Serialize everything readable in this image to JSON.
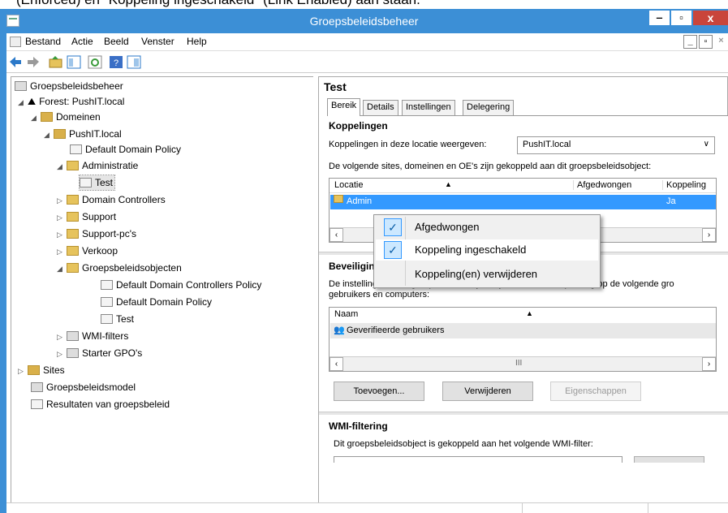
{
  "caption_fragment": "(Enforced) en \"Koppeling ingeschakeld\" (Link Enabled) aan staan.",
  "window": {
    "title": "Groepsbeleidsbeheer",
    "minimize": "‒",
    "maximize": "▫",
    "close": "x"
  },
  "menu": {
    "items": [
      "Bestand",
      "Actie",
      "Beeld",
      "Venster",
      "Help"
    ]
  },
  "tree": {
    "root": "Groepsbeleidsbeheer",
    "forest": "Forest: PushIT.local",
    "domains": "Domeinen",
    "domain": "PushIT.local",
    "ddp_link": "Default Domain Policy",
    "administratie": "Administratie",
    "test_link": "Test",
    "dc": "Domain Controllers",
    "support": "Support",
    "support_pc": "Support-pc's",
    "verkoop": "Verkoop",
    "gpo_container": "Groepsbeleidsobjecten",
    "gpo1": "Default Domain Controllers Policy",
    "gpo2": "Default Domain Policy",
    "gpo3": "Test",
    "wmi": "WMI-filters",
    "starter": "Starter GPO's",
    "sites": "Sites",
    "model": "Groepsbeleidsmodel",
    "results": "Resultaten van groepsbeleid"
  },
  "details": {
    "header": "Test",
    "tabs": [
      "Bereik",
      "Details",
      "Instellingen",
      "Delegering"
    ],
    "links_section": "Koppelingen",
    "links_location_label": "Koppelingen in deze locatie weergeven:",
    "links_location_value": "PushIT.local",
    "links_desc": "De volgende sites, domeinen en OE's zijn gekoppeld aan dit groepsbeleidsobject:",
    "links_cols": [
      "Locatie",
      "Afgedwongen",
      "Koppeling"
    ],
    "links_row": {
      "location": "Admin",
      "linked": "Ja"
    },
    "security_section": "Beveiligingsfiltering",
    "security_desc_1": "De instellingen in dit groepsbeleidsobject zijn alleen van toepassing op de volgende gro",
    "security_desc_2": "gebruikers en computers:",
    "security_col": "Naam",
    "security_row": "Geverifieerde gebruikers",
    "btn_add": "Toevoegen...",
    "btn_remove": "Verwijderen",
    "btn_props": "Eigenschappen",
    "wmi_section": "WMI-filtering",
    "wmi_desc": "Dit groepsbeleidsobject is gekoppeld aan het volgende WMI-filter:",
    "scroll_mid": "III"
  },
  "context_menu": {
    "items": [
      {
        "label": "Afgedwongen",
        "checked": true
      },
      {
        "label": "Koppeling ingeschakeld",
        "checked": true
      },
      {
        "label": "Koppeling(en) verwijderen",
        "checked": false
      }
    ]
  },
  "colors": {
    "titlebar": "#3c8fd6",
    "close": "#c9453b",
    "selection": "#3399ff"
  }
}
